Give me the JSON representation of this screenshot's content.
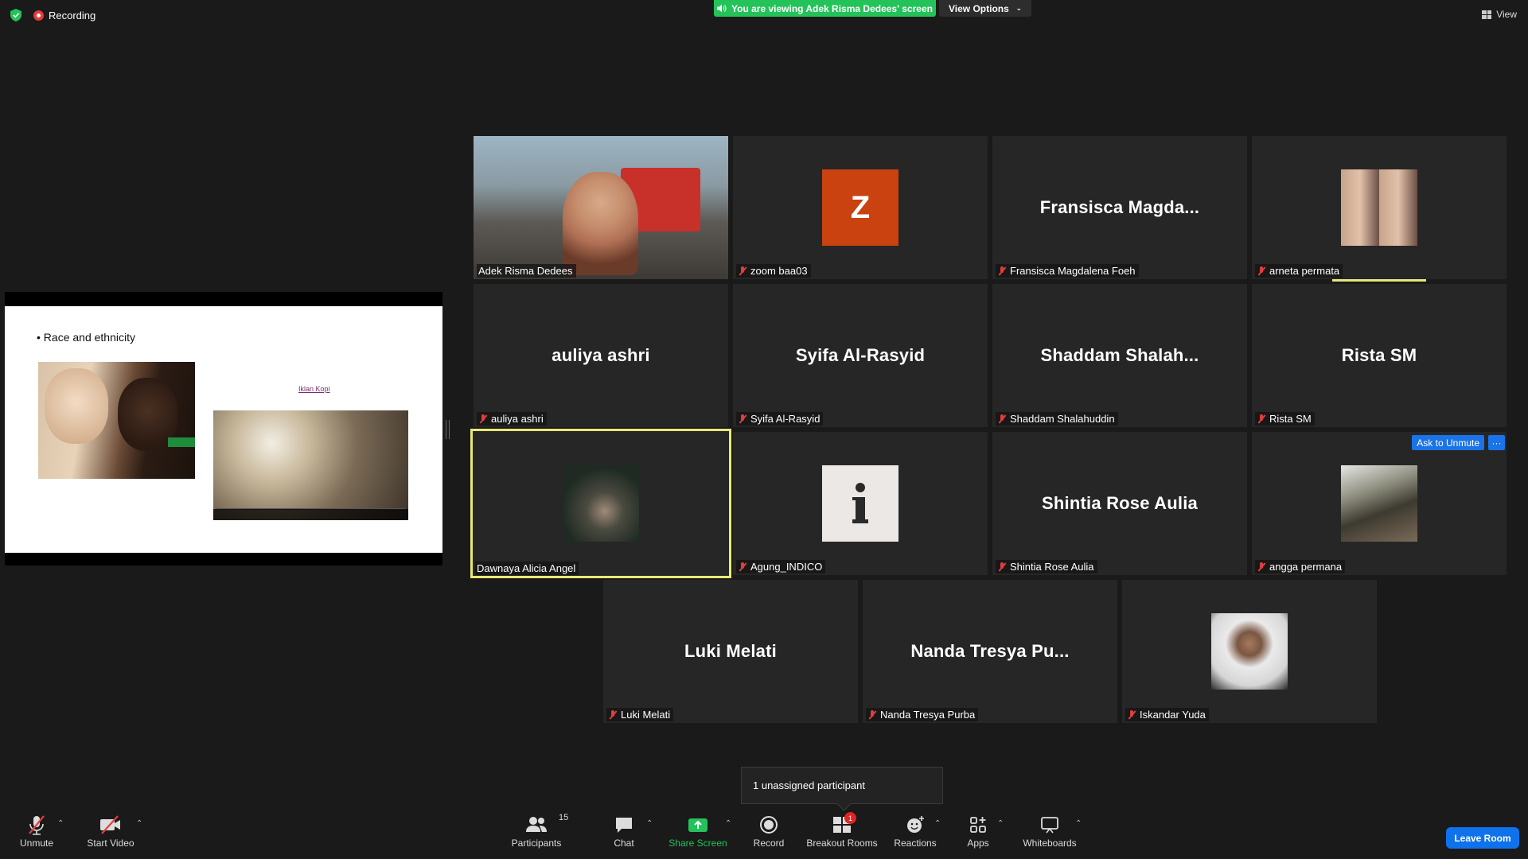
{
  "top": {
    "recording_label": "Recording",
    "viewing_banner": "You are viewing Adek Risma Dedees' screen",
    "view_options_label": "View Options",
    "view_label": "View"
  },
  "share": {
    "bullet": "Race and ethnicity",
    "link_text": "Iklan Kopi"
  },
  "tiles": [
    {
      "big": "",
      "label": "Adek Risma Dedees",
      "muted": false
    },
    {
      "big": "Z",
      "label": "zoom baa03",
      "muted": true
    },
    {
      "big": "Fransisca  Magda...",
      "label": "Fransisca Magdalena Foeh",
      "muted": true
    },
    {
      "big": "",
      "label": "arneta permata",
      "muted": true
    },
    {
      "big": "auliya ashri",
      "label": "auliya ashri",
      "muted": true
    },
    {
      "big": "Syifa Al-Rasyid",
      "label": "Syifa Al-Rasyid",
      "muted": true
    },
    {
      "big": "Shaddam  Shalah...",
      "label": "Shaddam Shalahuddin",
      "muted": true
    },
    {
      "big": "Rista SM",
      "label": "Rista SM",
      "muted": true
    },
    {
      "big": "",
      "label": "Dawnaya Alicia Angel",
      "muted": false
    },
    {
      "big": "",
      "label": "Agung_INDICO",
      "muted": true
    },
    {
      "big": "Shintia Rose Aulia",
      "label": "Shintia Rose Aulia",
      "muted": true
    },
    {
      "big": "",
      "label": "angga permana",
      "muted": true
    },
    {
      "big": "Luki Melati",
      "label": "Luki Melati",
      "muted": true
    },
    {
      "big": "Nanda  Tresya  Pu...",
      "label": "Nanda Tresya Purba",
      "muted": true
    },
    {
      "big": "",
      "label": "Iskandar Yuda",
      "muted": true
    }
  ],
  "ask_to_unmute": "Ask to Unmute",
  "more_label": "···",
  "tooltip": "1 unassigned participant",
  "toolbar": {
    "unmute": "Unmute",
    "start_video": "Start Video",
    "participants": "Participants",
    "participants_count": "15",
    "chat": "Chat",
    "share_screen": "Share Screen",
    "record": "Record",
    "breakout_rooms": "Breakout Rooms",
    "breakout_badge": "1",
    "reactions": "Reactions",
    "apps": "Apps",
    "whiteboards": "Whiteboards",
    "leave": "Leave Room"
  },
  "colors": {
    "banner_green": "#23c35a",
    "leave_blue": "#0e72ed",
    "active_speaker": "#e8e87a",
    "muted_red": "#e03e3e"
  }
}
